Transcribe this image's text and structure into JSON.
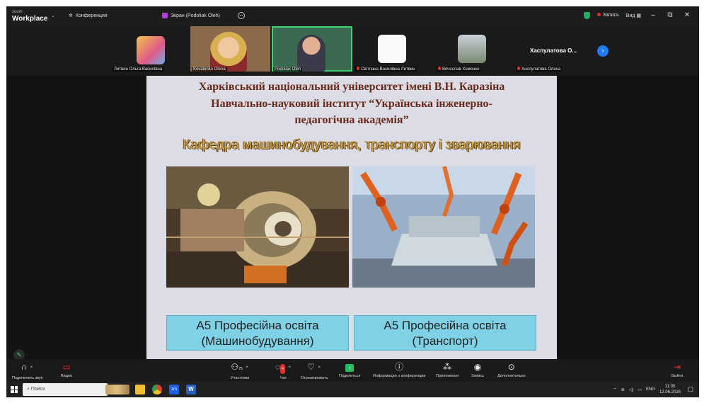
{
  "titlebar": {
    "app_small": "zoom",
    "app_name": "Workplace",
    "conference": "Конференция",
    "share_title": "Экран (Podoliak Oleh)",
    "record": "Запись",
    "view": "Вид"
  },
  "participants": [
    {
      "name": "Литвин Ольга Василівна",
      "muted": false
    },
    {
      "name": "Kovalenko Olena",
      "muted": false
    },
    {
      "name": "Podoliak Oleh",
      "muted": false
    },
    {
      "name": "Світлана Василівна Литвин",
      "muted": true
    },
    {
      "name": "Вячеслав Хоменко",
      "muted": true
    },
    {
      "name": "Хаспулатова Олена",
      "muted": true
    }
  ],
  "big_name": "Хаспулатова О...",
  "slide": {
    "line1": "Харківський національний університет імені В.Н. Каразіна",
    "line2": "Навчально-науковий інститут “Українська інженерно-",
    "line3": "педагогічна академія”",
    "dept": "Кафедра машинобудування, транспорту і зварювання",
    "box_left_1": "А5 Професійна освіта",
    "box_left_2": "(Машинобудування)",
    "box_right_1": "А5 Професійна освіта",
    "box_right_2": "(Транспорт)"
  },
  "toolbar": {
    "audio": "Подключить звук",
    "video": "Видео",
    "participants": "Участники",
    "participants_count": "75",
    "chat": "Чат",
    "chat_badge": "4",
    "react": "Отреагировать",
    "share": "Поделиться",
    "info": "Информация о конференции",
    "apps": "Приложения",
    "record": "Запись",
    "more": "Дополнительно",
    "leave": "Выйти"
  },
  "taskbar": {
    "search": "Поиск",
    "lang": "ENG",
    "time": "11:05",
    "date": "12.06.2026"
  }
}
